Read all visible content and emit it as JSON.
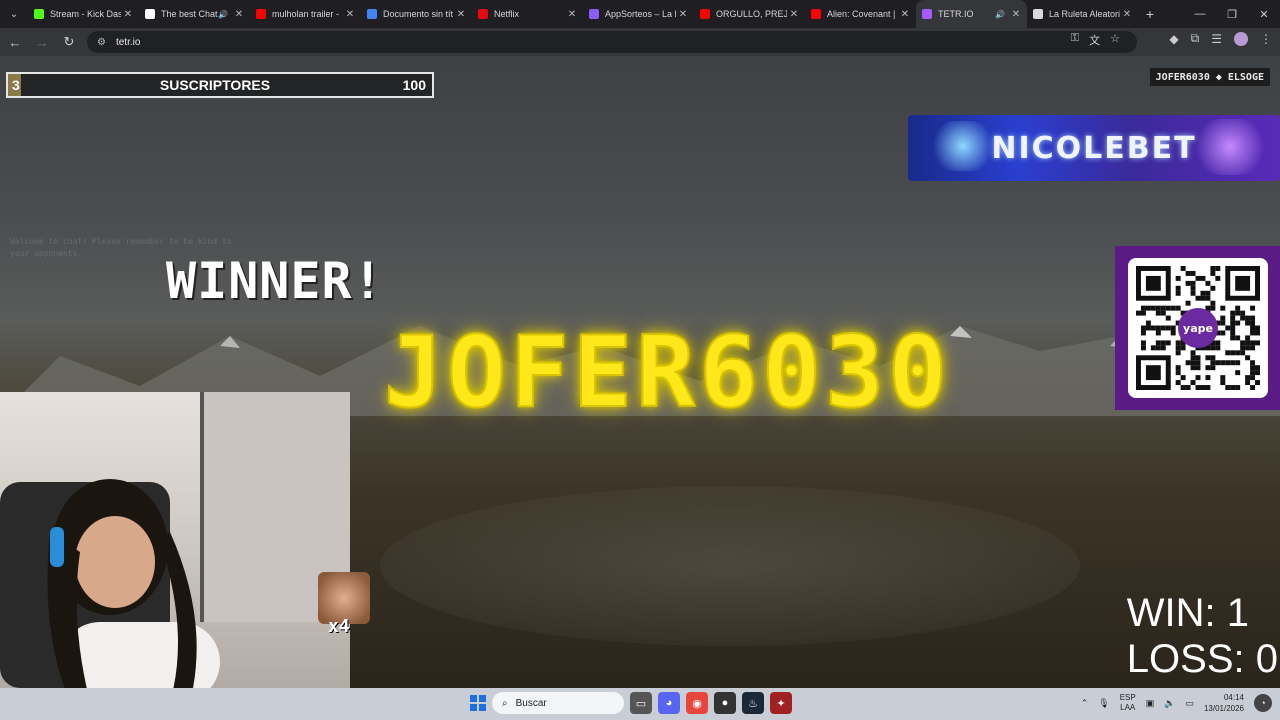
{
  "browser": {
    "tabs": [
      {
        "title": "Stream - Kick Dash",
        "favicon_color": "#53fc18",
        "sound": false
      },
      {
        "title": "The best Chat",
        "favicon_color": "#ffffff",
        "sound": true
      },
      {
        "title": "mulholan trailer -",
        "favicon_color": "#ff0000",
        "sound": false
      },
      {
        "title": "Documento sin tít",
        "favicon_color": "#4285f4",
        "sound": false
      },
      {
        "title": "Netflix",
        "favicon_color": "#e50914",
        "sound": false
      },
      {
        "title": "AppSorteos – La R",
        "favicon_color": "#8b5cf6",
        "sound": false
      },
      {
        "title": "ORGULLO, PREJUI",
        "favicon_color": "#ff0000",
        "sound": false
      },
      {
        "title": "Alien: Covenant |",
        "favicon_color": "#ff0000",
        "sound": false
      },
      {
        "title": "TETR.IO",
        "favicon_color": "#a35cff",
        "sound": true
      },
      {
        "title": "La Ruleta Aleatori",
        "favicon_color": "#d9d9d9",
        "sound": false
      }
    ],
    "url": "tetr.io"
  },
  "overlay": {
    "subs_current": "3",
    "subs_label": "SUSCRIPTORES",
    "subs_goal": "100",
    "subs_progress": 0.03,
    "match_player1": "JOFER6030",
    "match_player2": "ELSOGE",
    "banner_text": "NICOLEBET",
    "qr_label": "yape",
    "winner_label": "WINNER!",
    "winner_name": "JOFER6030",
    "win_label": "WIN: 1",
    "loss_label": "LOSS: 0",
    "emote_multiplier": "x4",
    "chat_ghost": "Welcome to chat! Please remember to be kind to your opponents."
  },
  "taskbar": {
    "search_placeholder": "Buscar",
    "lang_line1": "ESP",
    "lang_line2": "LAA",
    "time": "04:14",
    "date": "13/01/2026"
  },
  "colors": {
    "winner_glow": "#ffe81a",
    "qr_panel": "#5a1b86",
    "banner_start": "#182a8a",
    "banner_end": "#5a2ab8"
  }
}
